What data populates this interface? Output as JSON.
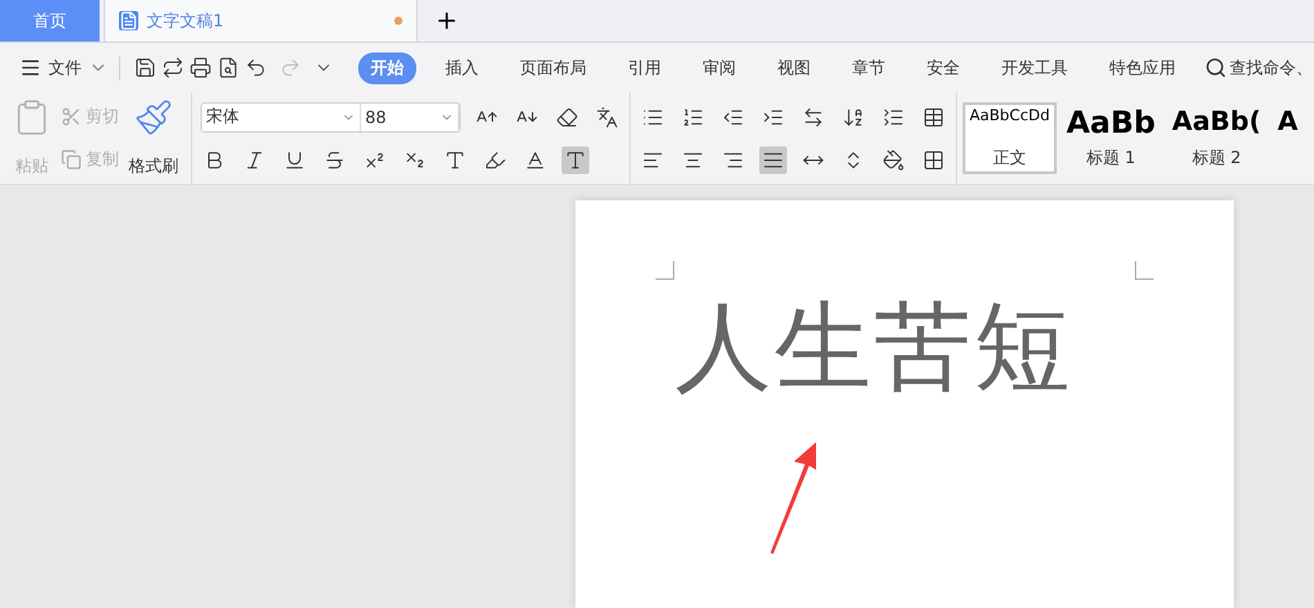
{
  "tabs": [
    {
      "kind": "home",
      "label": "首页",
      "selected": false
    },
    {
      "kind": "doc",
      "label": "文字文稿1",
      "selected": true,
      "unsaved": true
    }
  ],
  "menu": {
    "file": "文件",
    "ribbon_tabs": [
      {
        "label": "开始",
        "selected": true
      },
      {
        "label": "插入",
        "selected": false
      },
      {
        "label": "页面布局",
        "selected": false
      },
      {
        "label": "引用",
        "selected": false
      },
      {
        "label": "审阅",
        "selected": false
      },
      {
        "label": "视图",
        "selected": false
      },
      {
        "label": "章节",
        "selected": false
      },
      {
        "label": "安全",
        "selected": false
      },
      {
        "label": "开发工具",
        "selected": false
      },
      {
        "label": "特色应用",
        "selected": false
      }
    ],
    "search": {
      "placeholder": "查找命令、"
    }
  },
  "clipboard": {
    "paste": {
      "label": "粘贴",
      "disabled": true
    },
    "cut": {
      "label": "剪切",
      "disabled": true
    },
    "copy": {
      "label": "复制",
      "disabled": true
    },
    "format_painter": {
      "label": "格式刷",
      "disabled": false
    }
  },
  "font": {
    "name": "宋体",
    "size": "88"
  },
  "alignment": [
    {
      "kind": "left",
      "selected": false
    },
    {
      "kind": "center",
      "selected": false
    },
    {
      "kind": "right",
      "selected": false
    },
    {
      "kind": "justify",
      "selected": true
    },
    {
      "kind": "distributed",
      "selected": false
    }
  ],
  "styles": [
    {
      "sample": "AaBbCcDd",
      "label": "正文",
      "kind": "body",
      "selected": true
    },
    {
      "sample": "AaBb",
      "label": "标题 1",
      "kind": "h1",
      "selected": false
    },
    {
      "sample": "AaBb(",
      "label": "标题 2",
      "kind": "h2",
      "selected": false
    },
    {
      "sample": "A",
      "kind": "more",
      "selected": false
    }
  ],
  "document": {
    "text": "人生苦短"
  }
}
